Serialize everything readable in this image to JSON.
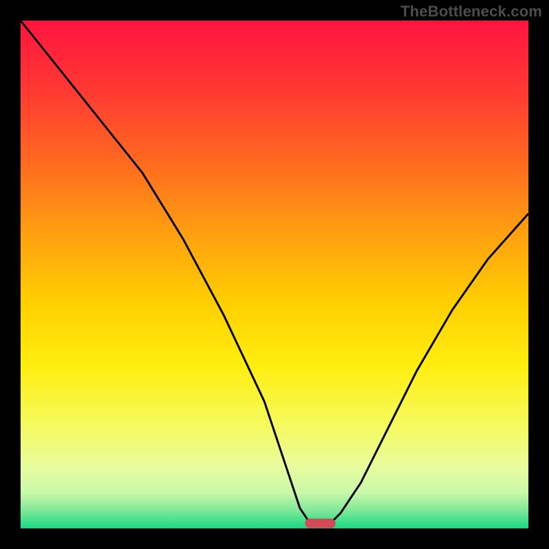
{
  "watermark": "TheBottleneck.com",
  "chart_data": {
    "type": "line",
    "title": "",
    "xlabel": "",
    "ylabel": "",
    "xlim": [
      0,
      100
    ],
    "ylim": [
      0,
      100
    ],
    "grid": false,
    "legend": false,
    "series": [
      {
        "name": "bottleneck-curve",
        "x": [
          0,
          8,
          16,
          24,
          32,
          40,
          48,
          52,
          55,
          57,
          59,
          61,
          63,
          67,
          72,
          78,
          85,
          92,
          100
        ],
        "y": [
          100,
          90,
          80,
          70,
          57,
          42,
          25,
          13,
          4,
          1,
          1,
          1,
          3,
          9,
          19,
          31,
          43,
          53,
          62
        ]
      }
    ],
    "marker": {
      "name": "optimal-range",
      "x_start": 56,
      "x_end": 62,
      "y": 1,
      "color": "#d14a56"
    },
    "background_gradient": {
      "stops": [
        {
          "offset": 0.0,
          "color": "#ff1440"
        },
        {
          "offset": 0.14,
          "color": "#ff3a33"
        },
        {
          "offset": 0.28,
          "color": "#ff6a1f"
        },
        {
          "offset": 0.42,
          "color": "#ffa010"
        },
        {
          "offset": 0.56,
          "color": "#ffd000"
        },
        {
          "offset": 0.68,
          "color": "#ffee10"
        },
        {
          "offset": 0.8,
          "color": "#f5fa60"
        },
        {
          "offset": 0.88,
          "color": "#e8fca0"
        },
        {
          "offset": 0.93,
          "color": "#c8f8a8"
        },
        {
          "offset": 0.965,
          "color": "#7ee898"
        },
        {
          "offset": 1.0,
          "color": "#17d884"
        }
      ]
    },
    "frame_color": "#000000",
    "frame_thickness": 30
  }
}
